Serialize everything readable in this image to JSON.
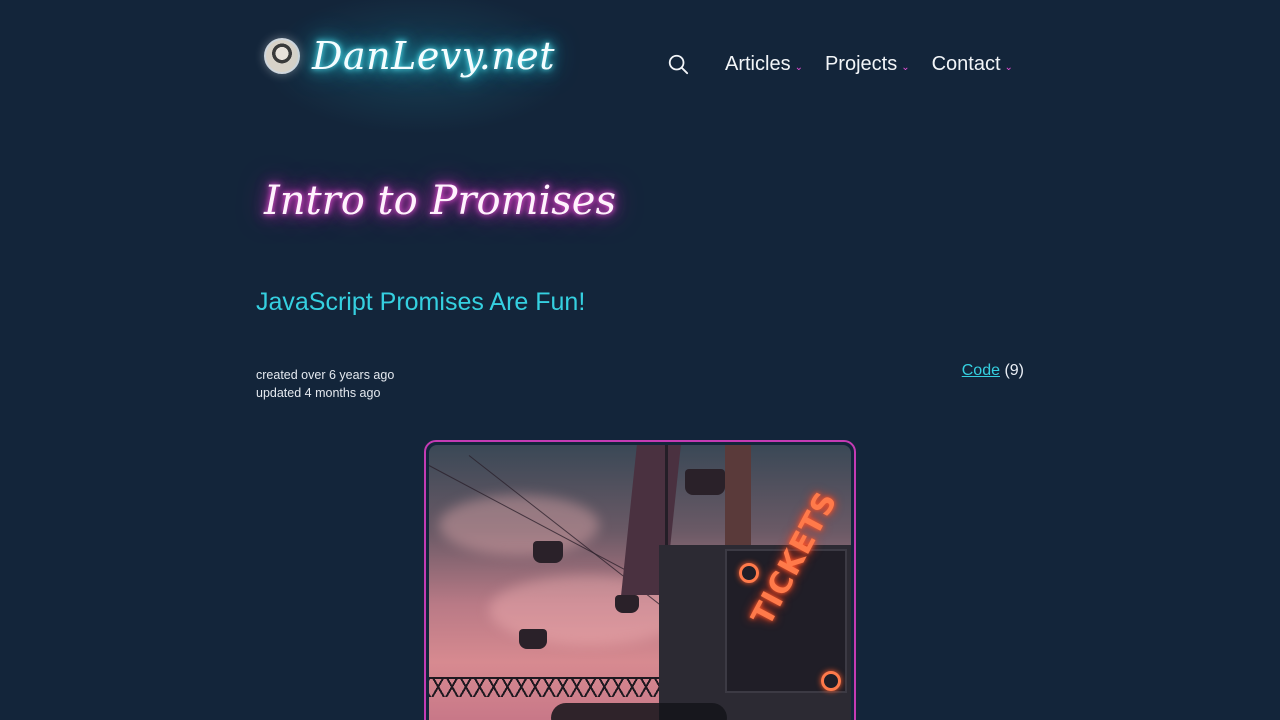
{
  "header": {
    "site_name": "DanLevy.net",
    "avatar": "avatar",
    "search_icon": "search-icon",
    "nav": [
      {
        "label": "Articles",
        "caret": "⌄"
      },
      {
        "label": "Projects",
        "caret": "⌄"
      },
      {
        "label": "Contact",
        "caret": "⌄"
      }
    ]
  },
  "post": {
    "title": "Intro to Promises",
    "subtitle": "JavaScript Promises Are Fun!",
    "created": "created over 6 years ago",
    "updated": "updated 4 months ago",
    "tag_label": "Code",
    "tag_count": "(9)",
    "hero_sign_text": "TICKETS"
  },
  "colors": {
    "background": "#13253a",
    "cyan_accent": "#35d0e0",
    "magenta_accent": "#c43bb4"
  }
}
